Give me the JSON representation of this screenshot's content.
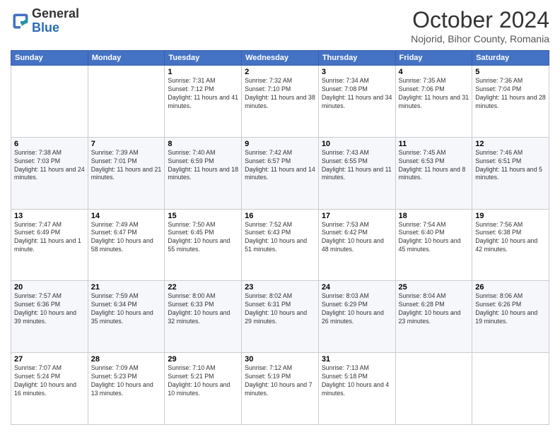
{
  "header": {
    "logo_line1": "General",
    "logo_line2": "Blue",
    "month_title": "October 2024",
    "subtitle": "Nojorid, Bihor County, Romania"
  },
  "days_of_week": [
    "Sunday",
    "Monday",
    "Tuesday",
    "Wednesday",
    "Thursday",
    "Friday",
    "Saturday"
  ],
  "weeks": [
    [
      {
        "day": "",
        "sunrise": "",
        "sunset": "",
        "daylight": ""
      },
      {
        "day": "",
        "sunrise": "",
        "sunset": "",
        "daylight": ""
      },
      {
        "day": "1",
        "sunrise": "Sunrise: 7:31 AM",
        "sunset": "Sunset: 7:12 PM",
        "daylight": "Daylight: 11 hours and 41 minutes."
      },
      {
        "day": "2",
        "sunrise": "Sunrise: 7:32 AM",
        "sunset": "Sunset: 7:10 PM",
        "daylight": "Daylight: 11 hours and 38 minutes."
      },
      {
        "day": "3",
        "sunrise": "Sunrise: 7:34 AM",
        "sunset": "Sunset: 7:08 PM",
        "daylight": "Daylight: 11 hours and 34 minutes."
      },
      {
        "day": "4",
        "sunrise": "Sunrise: 7:35 AM",
        "sunset": "Sunset: 7:06 PM",
        "daylight": "Daylight: 11 hours and 31 minutes."
      },
      {
        "day": "5",
        "sunrise": "Sunrise: 7:36 AM",
        "sunset": "Sunset: 7:04 PM",
        "daylight": "Daylight: 11 hours and 28 minutes."
      }
    ],
    [
      {
        "day": "6",
        "sunrise": "Sunrise: 7:38 AM",
        "sunset": "Sunset: 7:03 PM",
        "daylight": "Daylight: 11 hours and 24 minutes."
      },
      {
        "day": "7",
        "sunrise": "Sunrise: 7:39 AM",
        "sunset": "Sunset: 7:01 PM",
        "daylight": "Daylight: 11 hours and 21 minutes."
      },
      {
        "day": "8",
        "sunrise": "Sunrise: 7:40 AM",
        "sunset": "Sunset: 6:59 PM",
        "daylight": "Daylight: 11 hours and 18 minutes."
      },
      {
        "day": "9",
        "sunrise": "Sunrise: 7:42 AM",
        "sunset": "Sunset: 6:57 PM",
        "daylight": "Daylight: 11 hours and 14 minutes."
      },
      {
        "day": "10",
        "sunrise": "Sunrise: 7:43 AM",
        "sunset": "Sunset: 6:55 PM",
        "daylight": "Daylight: 11 hours and 11 minutes."
      },
      {
        "day": "11",
        "sunrise": "Sunrise: 7:45 AM",
        "sunset": "Sunset: 6:53 PM",
        "daylight": "Daylight: 11 hours and 8 minutes."
      },
      {
        "day": "12",
        "sunrise": "Sunrise: 7:46 AM",
        "sunset": "Sunset: 6:51 PM",
        "daylight": "Daylight: 11 hours and 5 minutes."
      }
    ],
    [
      {
        "day": "13",
        "sunrise": "Sunrise: 7:47 AM",
        "sunset": "Sunset: 6:49 PM",
        "daylight": "Daylight: 11 hours and 1 minute."
      },
      {
        "day": "14",
        "sunrise": "Sunrise: 7:49 AM",
        "sunset": "Sunset: 6:47 PM",
        "daylight": "Daylight: 10 hours and 58 minutes."
      },
      {
        "day": "15",
        "sunrise": "Sunrise: 7:50 AM",
        "sunset": "Sunset: 6:45 PM",
        "daylight": "Daylight: 10 hours and 55 minutes."
      },
      {
        "day": "16",
        "sunrise": "Sunrise: 7:52 AM",
        "sunset": "Sunset: 6:43 PM",
        "daylight": "Daylight: 10 hours and 51 minutes."
      },
      {
        "day": "17",
        "sunrise": "Sunrise: 7:53 AM",
        "sunset": "Sunset: 6:42 PM",
        "daylight": "Daylight: 10 hours and 48 minutes."
      },
      {
        "day": "18",
        "sunrise": "Sunrise: 7:54 AM",
        "sunset": "Sunset: 6:40 PM",
        "daylight": "Daylight: 10 hours and 45 minutes."
      },
      {
        "day": "19",
        "sunrise": "Sunrise: 7:56 AM",
        "sunset": "Sunset: 6:38 PM",
        "daylight": "Daylight: 10 hours and 42 minutes."
      }
    ],
    [
      {
        "day": "20",
        "sunrise": "Sunrise: 7:57 AM",
        "sunset": "Sunset: 6:36 PM",
        "daylight": "Daylight: 10 hours and 39 minutes."
      },
      {
        "day": "21",
        "sunrise": "Sunrise: 7:59 AM",
        "sunset": "Sunset: 6:34 PM",
        "daylight": "Daylight: 10 hours and 35 minutes."
      },
      {
        "day": "22",
        "sunrise": "Sunrise: 8:00 AM",
        "sunset": "Sunset: 6:33 PM",
        "daylight": "Daylight: 10 hours and 32 minutes."
      },
      {
        "day": "23",
        "sunrise": "Sunrise: 8:02 AM",
        "sunset": "Sunset: 6:31 PM",
        "daylight": "Daylight: 10 hours and 29 minutes."
      },
      {
        "day": "24",
        "sunrise": "Sunrise: 8:03 AM",
        "sunset": "Sunset: 6:29 PM",
        "daylight": "Daylight: 10 hours and 26 minutes."
      },
      {
        "day": "25",
        "sunrise": "Sunrise: 8:04 AM",
        "sunset": "Sunset: 6:28 PM",
        "daylight": "Daylight: 10 hours and 23 minutes."
      },
      {
        "day": "26",
        "sunrise": "Sunrise: 8:06 AM",
        "sunset": "Sunset: 6:26 PM",
        "daylight": "Daylight: 10 hours and 19 minutes."
      }
    ],
    [
      {
        "day": "27",
        "sunrise": "Sunrise: 7:07 AM",
        "sunset": "Sunset: 5:24 PM",
        "daylight": "Daylight: 10 hours and 16 minutes."
      },
      {
        "day": "28",
        "sunrise": "Sunrise: 7:09 AM",
        "sunset": "Sunset: 5:23 PM",
        "daylight": "Daylight: 10 hours and 13 minutes."
      },
      {
        "day": "29",
        "sunrise": "Sunrise: 7:10 AM",
        "sunset": "Sunset: 5:21 PM",
        "daylight": "Daylight: 10 hours and 10 minutes."
      },
      {
        "day": "30",
        "sunrise": "Sunrise: 7:12 AM",
        "sunset": "Sunset: 5:19 PM",
        "daylight": "Daylight: 10 hours and 7 minutes."
      },
      {
        "day": "31",
        "sunrise": "Sunrise: 7:13 AM",
        "sunset": "Sunset: 5:18 PM",
        "daylight": "Daylight: 10 hours and 4 minutes."
      },
      {
        "day": "",
        "sunrise": "",
        "sunset": "",
        "daylight": ""
      },
      {
        "day": "",
        "sunrise": "",
        "sunset": "",
        "daylight": ""
      }
    ]
  ]
}
